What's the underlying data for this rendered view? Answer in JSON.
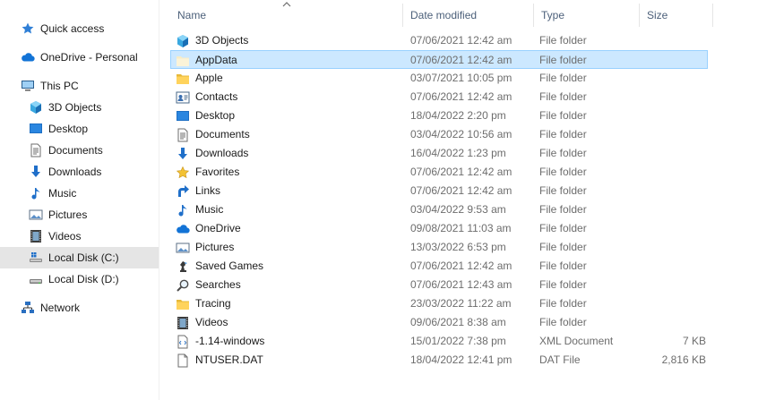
{
  "nav": {
    "items": [
      {
        "label": "Quick access",
        "icon": "star-icon"
      },
      {
        "label": "OneDrive - Personal",
        "icon": "cloud-icon"
      },
      {
        "label": "This PC",
        "icon": "computer-icon"
      },
      {
        "label": "3D Objects",
        "icon": "cube-icon"
      },
      {
        "label": "Desktop",
        "icon": "desktop-icon"
      },
      {
        "label": "Documents",
        "icon": "document-icon"
      },
      {
        "label": "Downloads",
        "icon": "download-arrow-icon"
      },
      {
        "label": "Music",
        "icon": "music-note-icon"
      },
      {
        "label": "Pictures",
        "icon": "picture-icon"
      },
      {
        "label": "Videos",
        "icon": "film-icon"
      },
      {
        "label": "Local Disk (C:)",
        "icon": "windows-drive-icon"
      },
      {
        "label": "Local Disk (D:)",
        "icon": "drive-icon"
      },
      {
        "label": "Network",
        "icon": "network-icon"
      }
    ]
  },
  "columns": {
    "name": "Name",
    "date": "Date modified",
    "type": "Type",
    "size": "Size"
  },
  "files": [
    {
      "name": "3D Objects",
      "date": "07/06/2021 12:42 am",
      "type": "File folder",
      "size": "",
      "icon": "cube-icon"
    },
    {
      "name": "AppData",
      "date": "07/06/2021 12:42 am",
      "type": "File folder",
      "size": "",
      "icon": "folder-pale-icon"
    },
    {
      "name": "Apple",
      "date": "03/07/2021 10:05 pm",
      "type": "File folder",
      "size": "",
      "icon": "folder-icon"
    },
    {
      "name": "Contacts",
      "date": "07/06/2021 12:42 am",
      "type": "File folder",
      "size": "",
      "icon": "contact-card-icon"
    },
    {
      "name": "Desktop",
      "date": "18/04/2022 2:20 pm",
      "type": "File folder",
      "size": "",
      "icon": "desktop-icon"
    },
    {
      "name": "Documents",
      "date": "03/04/2022 10:56 am",
      "type": "File folder",
      "size": "",
      "icon": "document-icon"
    },
    {
      "name": "Downloads",
      "date": "16/04/2022 1:23 pm",
      "type": "File folder",
      "size": "",
      "icon": "download-arrow-icon"
    },
    {
      "name": "Favorites",
      "date": "07/06/2021 12:42 am",
      "type": "File folder",
      "size": "",
      "icon": "star-icon"
    },
    {
      "name": "Links",
      "date": "07/06/2021 12:42 am",
      "type": "File folder",
      "size": "",
      "icon": "link-arrow-icon"
    },
    {
      "name": "Music",
      "date": "03/04/2022 9:53 am",
      "type": "File folder",
      "size": "",
      "icon": "music-note-icon"
    },
    {
      "name": "OneDrive",
      "date": "09/08/2021 11:03 am",
      "type": "File folder",
      "size": "",
      "icon": "cloud-icon"
    },
    {
      "name": "Pictures",
      "date": "13/03/2022 6:53 pm",
      "type": "File folder",
      "size": "",
      "icon": "picture-icon"
    },
    {
      "name": "Saved Games",
      "date": "07/06/2021 12:42 am",
      "type": "File folder",
      "size": "",
      "icon": "chess-piece-icon"
    },
    {
      "name": "Searches",
      "date": "07/06/2021 12:43 am",
      "type": "File folder",
      "size": "",
      "icon": "search-icon"
    },
    {
      "name": "Tracing",
      "date": "23/03/2022 11:22 am",
      "type": "File folder",
      "size": "",
      "icon": "folder-icon"
    },
    {
      "name": "Videos",
      "date": "09/06/2021 8:38 am",
      "type": "File folder",
      "size": "",
      "icon": "film-icon"
    },
    {
      "name": "-1.14-windows",
      "date": "15/01/2022 7:38 pm",
      "type": "XML Document",
      "size": "7 KB",
      "icon": "xml-file-icon"
    },
    {
      "name": "NTUSER.DAT",
      "date": "18/04/2022 12:41 pm",
      "type": "DAT File",
      "size": "2,816 KB",
      "icon": "blank-file-icon"
    }
  ],
  "selected_file": "AppData",
  "selected_nav": "Local Disk (C:)",
  "colors": {
    "selection_bg": "#cce8ff",
    "selection_border": "#99d1ff",
    "header_text": "#4c607a",
    "nav_selected": "#e5e5e5"
  }
}
